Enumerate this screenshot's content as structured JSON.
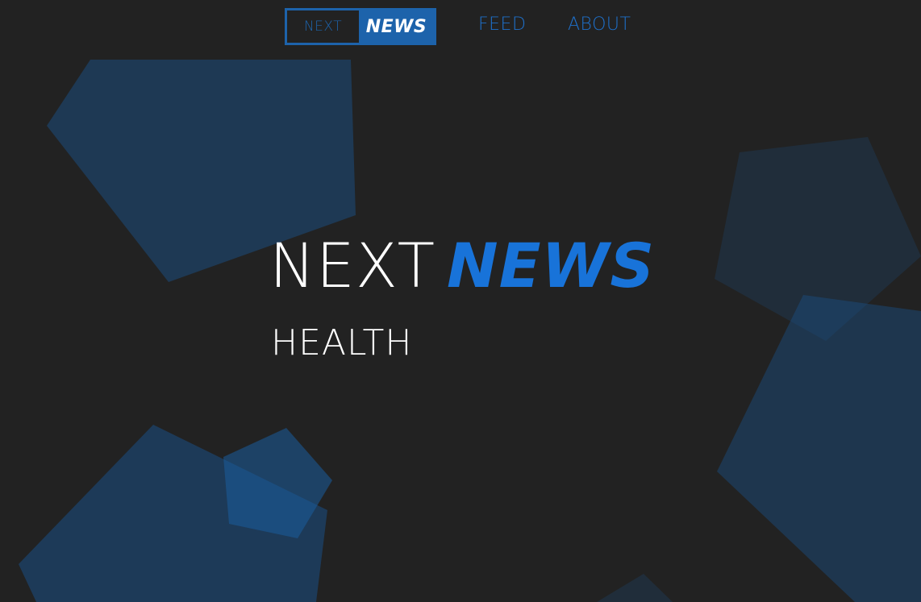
{
  "nav": {
    "logo_next": "NEXT",
    "logo_news": "NEWS",
    "links": [
      {
        "label": "FEED"
      },
      {
        "label": "ABOUT"
      }
    ]
  },
  "hero": {
    "title_next": "NEXT",
    "title_news": "NEWS",
    "subtitle": "HEALTH"
  },
  "colors": {
    "background": "#222222",
    "brand_blue": "#1873d9",
    "logo_blue": "#1d63ab",
    "shape_blue": "#1e5fa3"
  }
}
